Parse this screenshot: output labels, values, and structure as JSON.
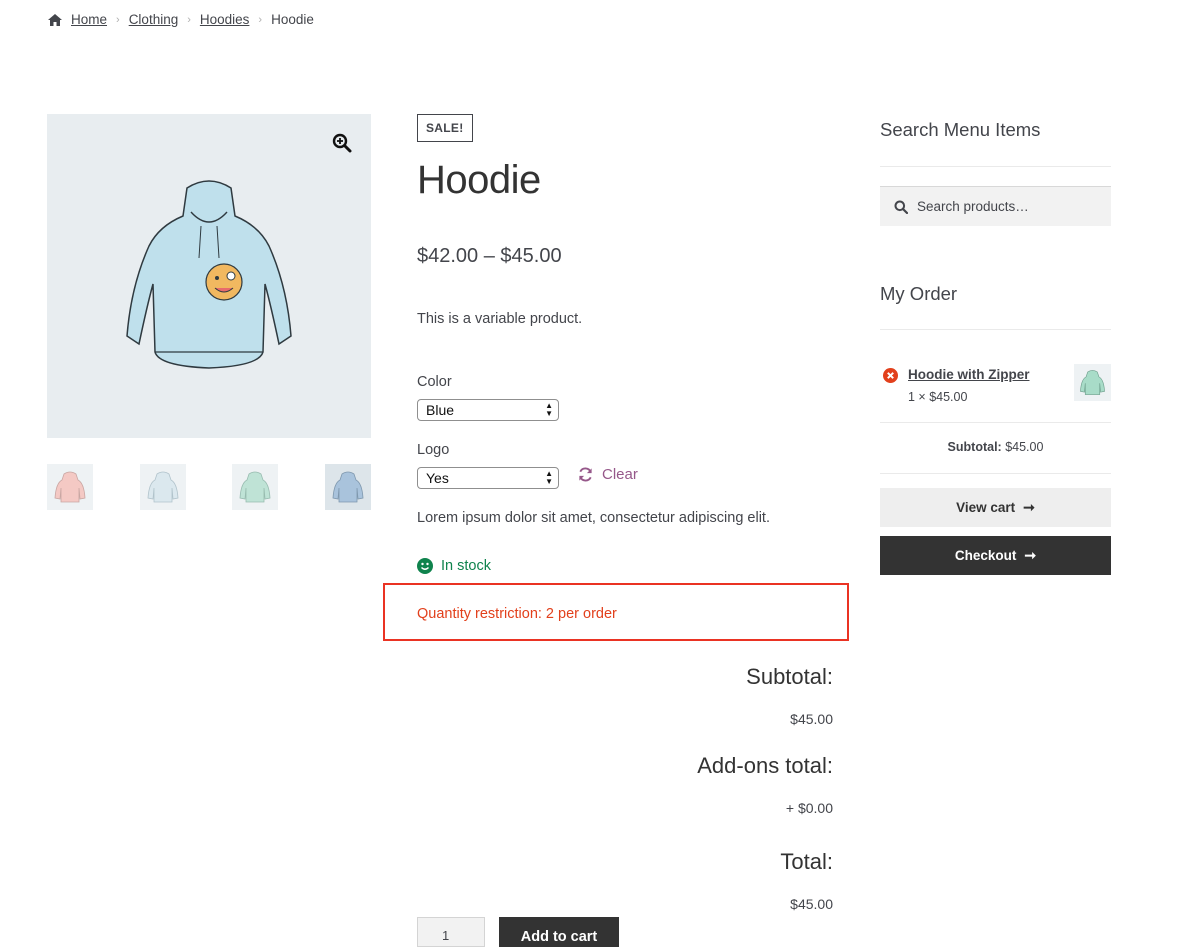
{
  "breadcrumb": {
    "home": "Home",
    "items": [
      "Clothing",
      "Hoodies"
    ],
    "current": "Hoodie",
    "separator": "›"
  },
  "gallery": {
    "thumbnails": [
      {
        "color": "#f4c9c4"
      },
      {
        "color": "#dbe8ee"
      },
      {
        "color": "#bfe3d6"
      },
      {
        "color": "#a9c3dc"
      }
    ]
  },
  "product": {
    "badge": "SALE!",
    "title": "Hoodie",
    "price": "$42.00 – $45.00",
    "short_description": "This is a variable product.",
    "variations": {
      "color_label": "Color",
      "color_value": "Blue",
      "logo_label": "Logo",
      "logo_value": "Yes",
      "clear_label": "Clear"
    },
    "description": "Lorem ipsum dolor sit amet, consectetur adipiscing elit.",
    "stock": "In stock",
    "restriction": "Quantity restriction: 2 per order",
    "totals": {
      "subtotal_label": "Subtotal:",
      "subtotal_value": "$45.00",
      "addons_label": "Add-ons total:",
      "addons_value": "+ $0.00",
      "total_label": "Total:",
      "total_value": "$45.00"
    },
    "quantity": "1",
    "add_to_cart": "Add to cart"
  },
  "sidebar": {
    "search_title": "Search Menu Items",
    "search_placeholder": "Search products…",
    "order_title": "My Order",
    "cart_item": {
      "name": "Hoodie with Zipper",
      "qty_price": "1 × $45.00"
    },
    "subtotal_label": "Subtotal:",
    "subtotal_value": "$45.00",
    "view_cart": "View cart",
    "checkout": "Checkout"
  },
  "colors": {
    "accent": "#96588a",
    "stock": "#0f834d",
    "restriction": "#e2401c",
    "highlight_box": "#ea3323"
  }
}
